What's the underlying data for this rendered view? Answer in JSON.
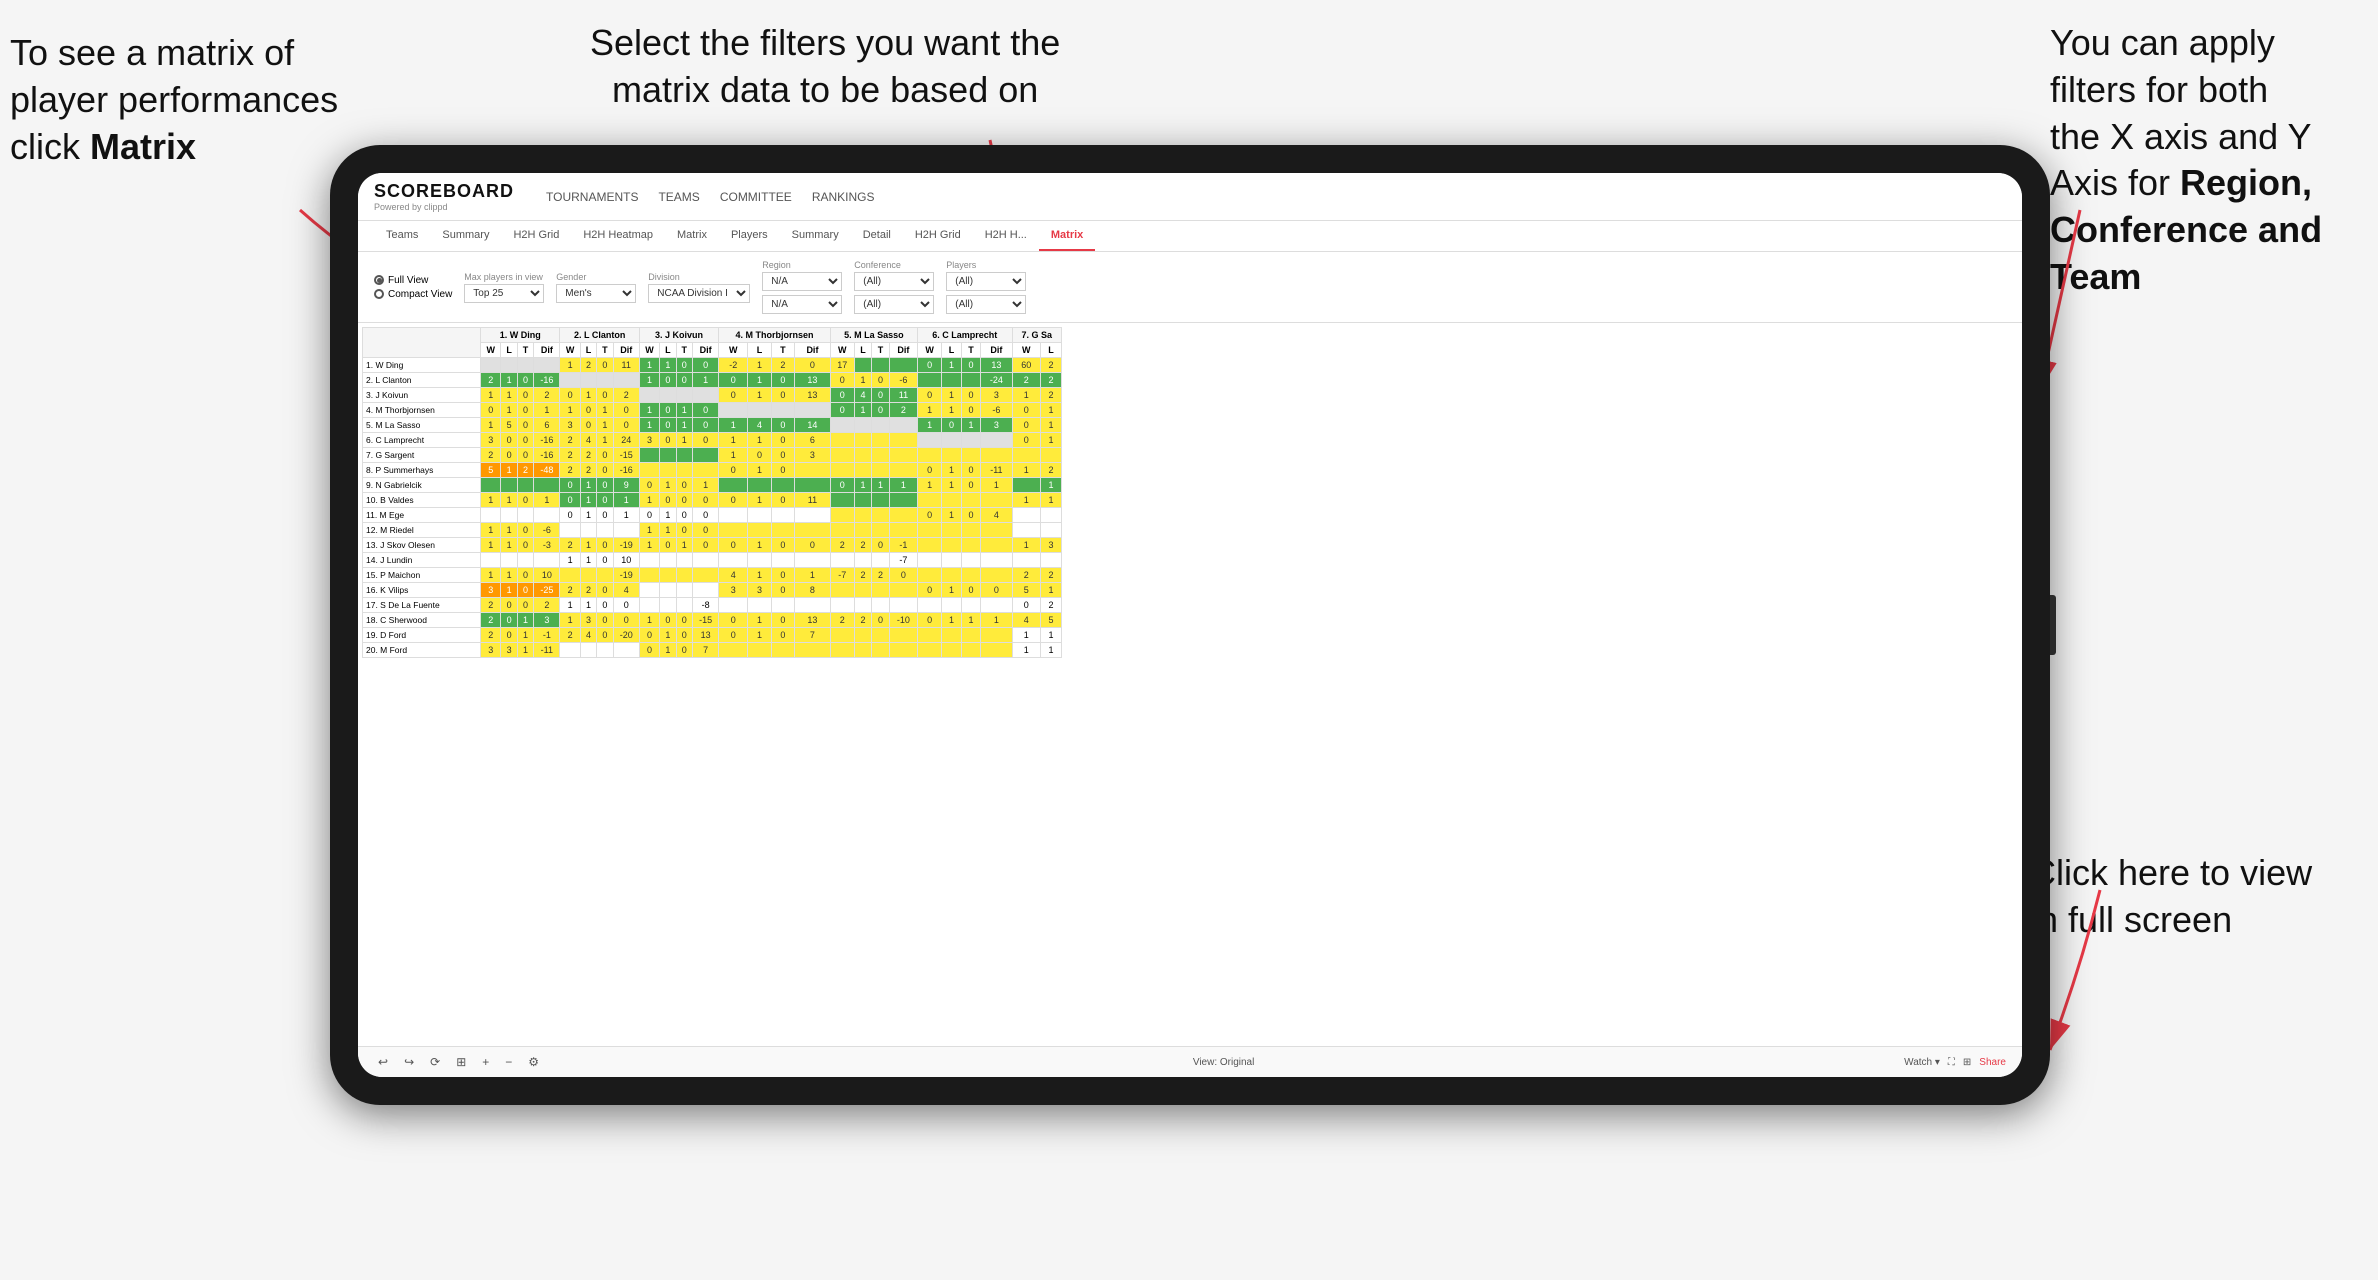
{
  "annotations": {
    "top_left": {
      "line1": "To see a matrix of",
      "line2": "player performances",
      "line3_prefix": "click ",
      "line3_bold": "Matrix"
    },
    "top_center": {
      "line1": "Select the filters you want the",
      "line2": "matrix data to be based on"
    },
    "top_right": {
      "line1": "You  can apply",
      "line2": "filters for both",
      "line3": "the X axis and Y",
      "line4_prefix": "Axis for ",
      "line4_bold": "Region,",
      "line5_bold": "Conference and",
      "line6_bold": "Team"
    },
    "bottom_right": {
      "line1": "Click here to view",
      "line2": "in full screen"
    }
  },
  "scoreboard": {
    "logo_main": "SCOREBOARD",
    "logo_sub": "Powered by clippd",
    "nav_items": [
      "TOURNAMENTS",
      "TEAMS",
      "COMMITTEE",
      "RANKINGS"
    ]
  },
  "sub_tabs": [
    {
      "label": "Teams",
      "active": false
    },
    {
      "label": "Summary",
      "active": false
    },
    {
      "label": "H2H Grid",
      "active": false
    },
    {
      "label": "H2H Heatmap",
      "active": false
    },
    {
      "label": "Matrix",
      "active": false
    },
    {
      "label": "Players",
      "active": false
    },
    {
      "label": "Summary",
      "active": false
    },
    {
      "label": "Detail",
      "active": false
    },
    {
      "label": "H2H Grid",
      "active": false
    },
    {
      "label": "H2H H...",
      "active": false
    },
    {
      "label": "Matrix",
      "active": true
    }
  ],
  "filters": {
    "view_options": [
      "Full View",
      "Compact View"
    ],
    "selected_view": "Full View",
    "max_players_label": "Max players in view",
    "max_players_value": "Top 25",
    "gender_label": "Gender",
    "gender_value": "Men's",
    "division_label": "Division",
    "division_value": "NCAA Division I",
    "region_label": "Region",
    "region_value": "N/A",
    "region_value2": "N/A",
    "conference_label": "Conference",
    "conference_value": "(All)",
    "conference_value2": "(All)",
    "players_label": "Players",
    "players_value": "(All)",
    "players_value2": "(All)"
  },
  "column_headers": [
    {
      "name": "1. W Ding",
      "cols": [
        "W",
        "L",
        "T",
        "Dif"
      ]
    },
    {
      "name": "2. L Clanton",
      "cols": [
        "W",
        "L",
        "T",
        "Dif"
      ]
    },
    {
      "name": "3. J Koivun",
      "cols": [
        "W",
        "L",
        "T",
        "Dif"
      ]
    },
    {
      "name": "4. M Thorbjornsen",
      "cols": [
        "W",
        "L",
        "T",
        "Dif"
      ]
    },
    {
      "name": "5. M La Sasso",
      "cols": [
        "W",
        "L",
        "T",
        "Dif"
      ]
    },
    {
      "name": "6. C Lamprecht",
      "cols": [
        "W",
        "L",
        "T",
        "Dif"
      ]
    },
    {
      "name": "7. G Sa",
      "cols": [
        "W",
        "L"
      ]
    }
  ],
  "rows": [
    {
      "name": "1. W Ding"
    },
    {
      "name": "2. L Clanton"
    },
    {
      "name": "3. J Koivun"
    },
    {
      "name": "4. M Thorbjornsen"
    },
    {
      "name": "5. M La Sasso"
    },
    {
      "name": "6. C Lamprecht"
    },
    {
      "name": "7. G Sargent"
    },
    {
      "name": "8. P Summerhays"
    },
    {
      "name": "9. N Gabrielcik"
    },
    {
      "name": "10. B Valdes"
    },
    {
      "name": "11. M Ege"
    },
    {
      "name": "12. M Riedel"
    },
    {
      "name": "13. J Skov Olesen"
    },
    {
      "name": "14. J Lundin"
    },
    {
      "name": "15. P Maichon"
    },
    {
      "name": "16. K Vilips"
    },
    {
      "name": "17. S De La Fuente"
    },
    {
      "name": "18. C Sherwood"
    },
    {
      "name": "19. D Ford"
    },
    {
      "name": "20. M Ford"
    }
  ],
  "toolbar": {
    "view_label": "View: Original",
    "watch_label": "Watch ▾",
    "share_label": "Share"
  }
}
